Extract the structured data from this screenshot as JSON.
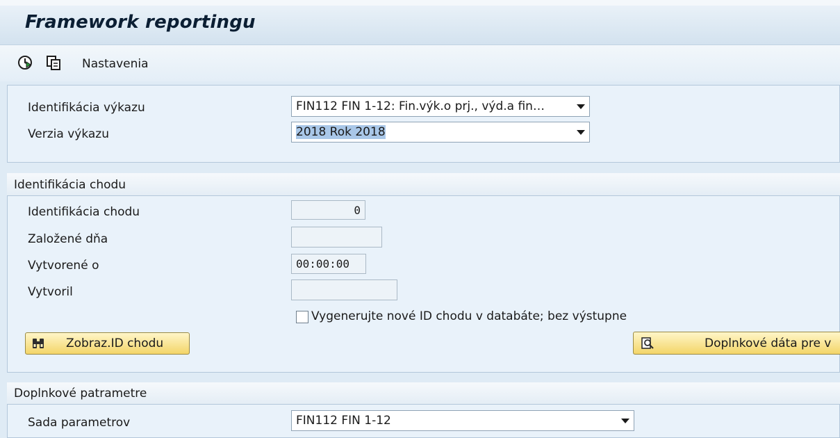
{
  "window": {
    "title": "Framework reportingu"
  },
  "toolbar": {
    "execute_icon": "execute-clock-icon",
    "variant_icon": "copy-variant-icon",
    "settings_label": "Nastavenia"
  },
  "report_section": {
    "fields": [
      {
        "label": "Identifikácia výkazu",
        "value": "FIN112 FIN 1-12: Fin.výk.o prj., výd.a fin…"
      },
      {
        "label": "Verzia výkazu",
        "value": "2018 Rok 2018"
      }
    ]
  },
  "run_section": {
    "title": "Identifikácia chodu",
    "fields": [
      {
        "label": "Identifikácia chodu",
        "value": "0"
      },
      {
        "label": "Založené dňa",
        "value": ""
      },
      {
        "label": "Vytvorené o",
        "value": "00:00:00"
      },
      {
        "label": "Vytvoril",
        "value": ""
      }
    ],
    "checkbox_label": "Vygenerujte nové ID chodu v databáte; bez výstupne",
    "checkbox_checked": false,
    "show_id_button": "Zobraz.ID chodu",
    "additional_data_button": "Doplnkové dáta pre v"
  },
  "params_section": {
    "title": "Doplnkové patrametre",
    "fields": [
      {
        "label": "Sada parametrov",
        "value": "FIN112 FIN 1-12"
      }
    ]
  }
}
